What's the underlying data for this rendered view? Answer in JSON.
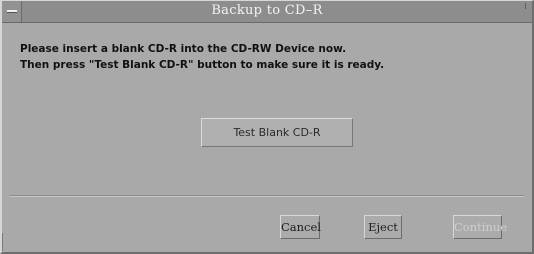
{
  "window": {
    "title": "Backup to CD–R"
  },
  "message": {
    "line1": "Please insert a blank CD-R into the CD-RW Device now.",
    "line2": "Then press \"Test Blank CD-R\" button to make sure it is ready."
  },
  "actions": {
    "test_blank_label": "Test Blank CD-R"
  },
  "footer": {
    "cancel_label": "Cancel",
    "eject_label": "Eject",
    "continue_label": "Continue",
    "continue_enabled": false
  }
}
